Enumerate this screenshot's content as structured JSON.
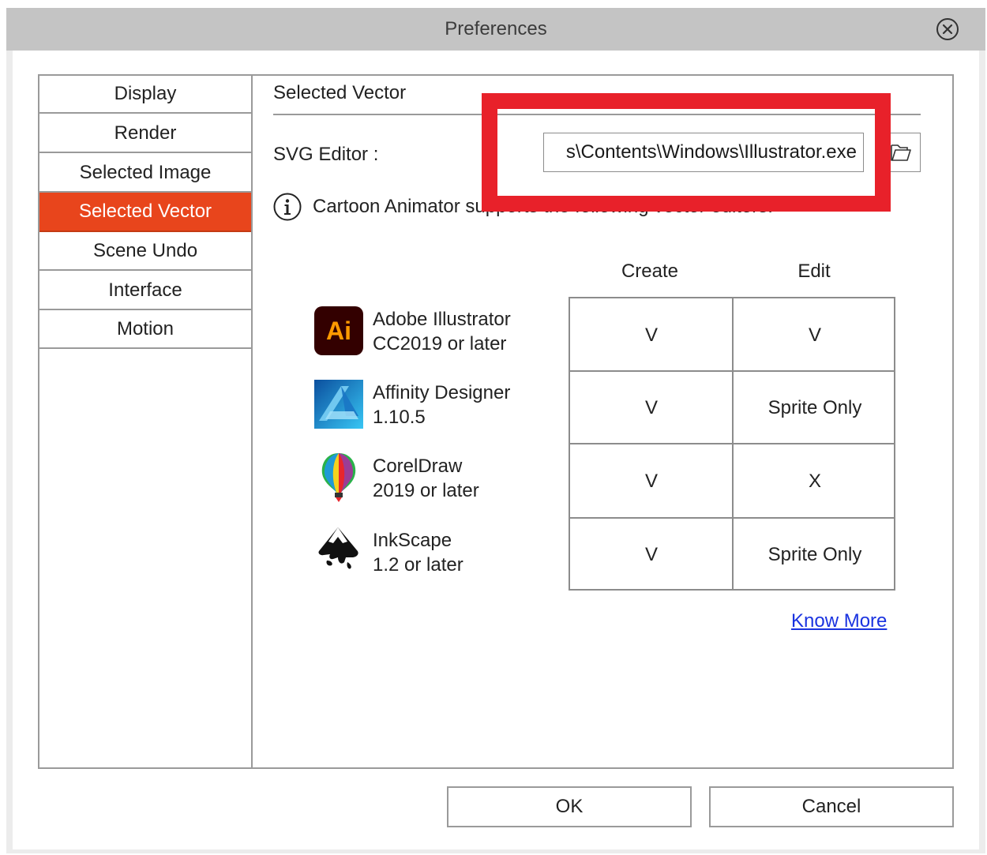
{
  "window": {
    "title": "Preferences"
  },
  "sidebar": {
    "items": [
      {
        "label": "Display"
      },
      {
        "label": "Render"
      },
      {
        "label": "Selected Image"
      },
      {
        "label": "Selected Vector",
        "active": true
      },
      {
        "label": "Scene Undo"
      },
      {
        "label": "Interface"
      },
      {
        "label": "Motion"
      }
    ]
  },
  "content": {
    "section_title": "Selected Vector",
    "svg_editor_label": "SVG Editor :",
    "svg_editor_value": "s\\Contents\\Windows\\Illustrator.exe",
    "info_text": "Cartoon Animator supports the following vector editors:",
    "columns": {
      "create": "Create",
      "edit": "Edit"
    },
    "editors": [
      {
        "icon": "adobe-illustrator-icon",
        "icon_text": "Ai",
        "name_line1": "Adobe Illustrator",
        "name_line2": "CC2019 or later",
        "create": "V",
        "edit": "V"
      },
      {
        "icon": "affinity-designer-icon",
        "name_line1": "Affinity Designer",
        "name_line2": "1.10.5",
        "create": "V",
        "edit": "Sprite Only"
      },
      {
        "icon": "coreldraw-icon",
        "name_line1": "CorelDraw",
        "name_line2": "2019 or later",
        "create": "V",
        "edit": "X"
      },
      {
        "icon": "inkscape-icon",
        "name_line1": "InkScape",
        "name_line2": "1.2 or later",
        "create": "V",
        "edit": "Sprite Only"
      }
    ],
    "know_more": "Know More"
  },
  "buttons": {
    "ok": "OK",
    "cancel": "Cancel"
  },
  "colors": {
    "accent": "#e8451c",
    "highlight": "#e8212a",
    "link": "#1a33e0",
    "titlebar": "#c4c4c4"
  }
}
